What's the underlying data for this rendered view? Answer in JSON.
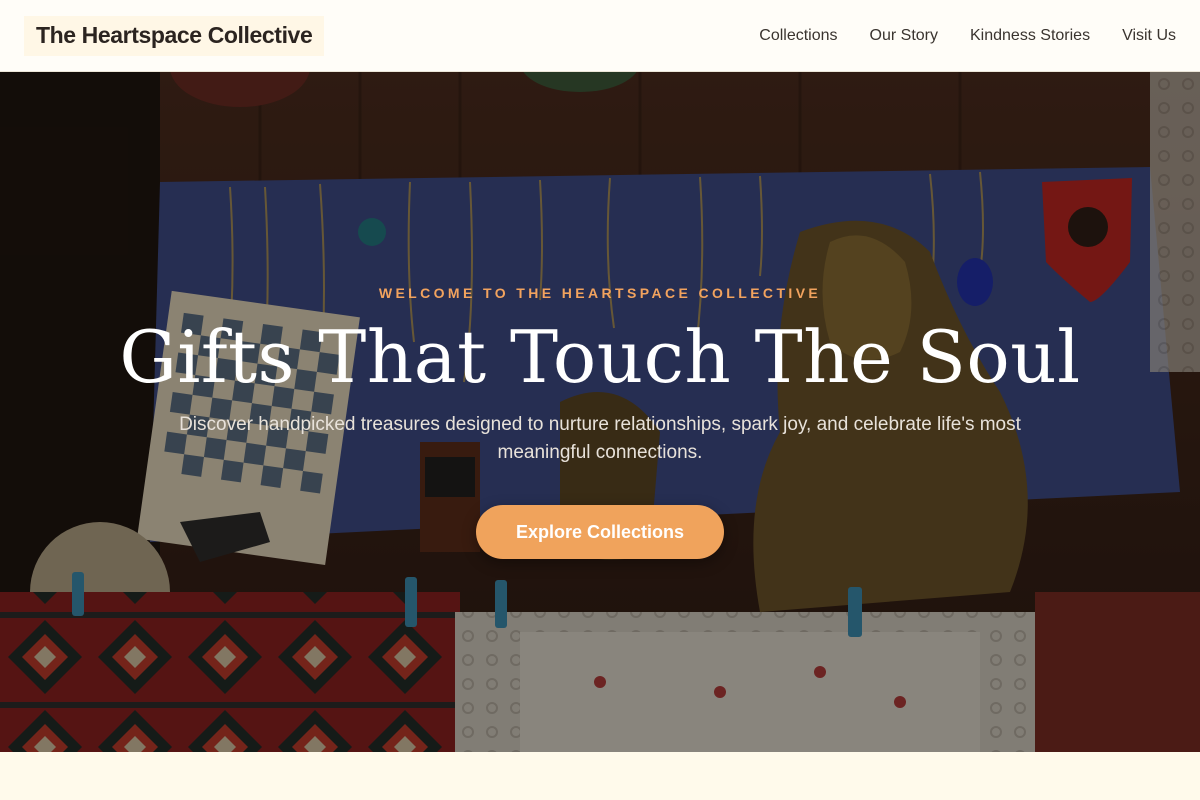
{
  "header": {
    "logo": "The Heartspace Collective",
    "nav": [
      {
        "label": "Collections"
      },
      {
        "label": "Our Story"
      },
      {
        "label": "Kindness Stories"
      },
      {
        "label": "Visit Us"
      }
    ]
  },
  "hero": {
    "eyebrow": "WELCOME TO THE HEARTSPACE COLLECTIVE",
    "title": "Gifts That Touch The Soul",
    "subtitle": "Discover handpicked treasures designed to nurture relationships, spark joy, and celebrate life's most meaningful connections.",
    "cta_label": "Explore Collections",
    "background_image": "market-stall-crafts-photo"
  },
  "colors": {
    "accent": "#f0a35c",
    "header_bg": "#fffdf8",
    "page_bg": "#fffaeb"
  }
}
